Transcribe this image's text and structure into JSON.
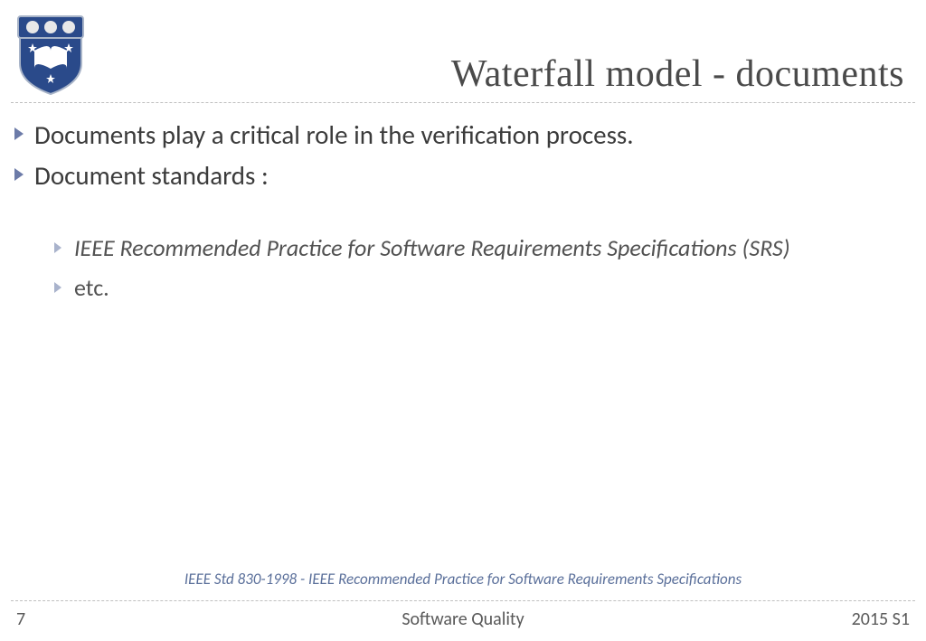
{
  "title": "Waterfall model - documents",
  "bullets": {
    "b1": "Documents play a critical role in the verification process.",
    "b2": "Document standards :",
    "sub1": "IEEE Recommended Practice for Software Requirements Specifications (SRS)",
    "sub2": "etc."
  },
  "reference": "IEEE Std 830-1998 - IEEE Recommended Practice for Software Requirements Specifications",
  "footer": {
    "page": "7",
    "center": "Software Quality",
    "right": "2015 S1"
  },
  "colors": {
    "bullet_arrow": "#6c7ba8",
    "sub_arrow": "#a9b3cc"
  }
}
